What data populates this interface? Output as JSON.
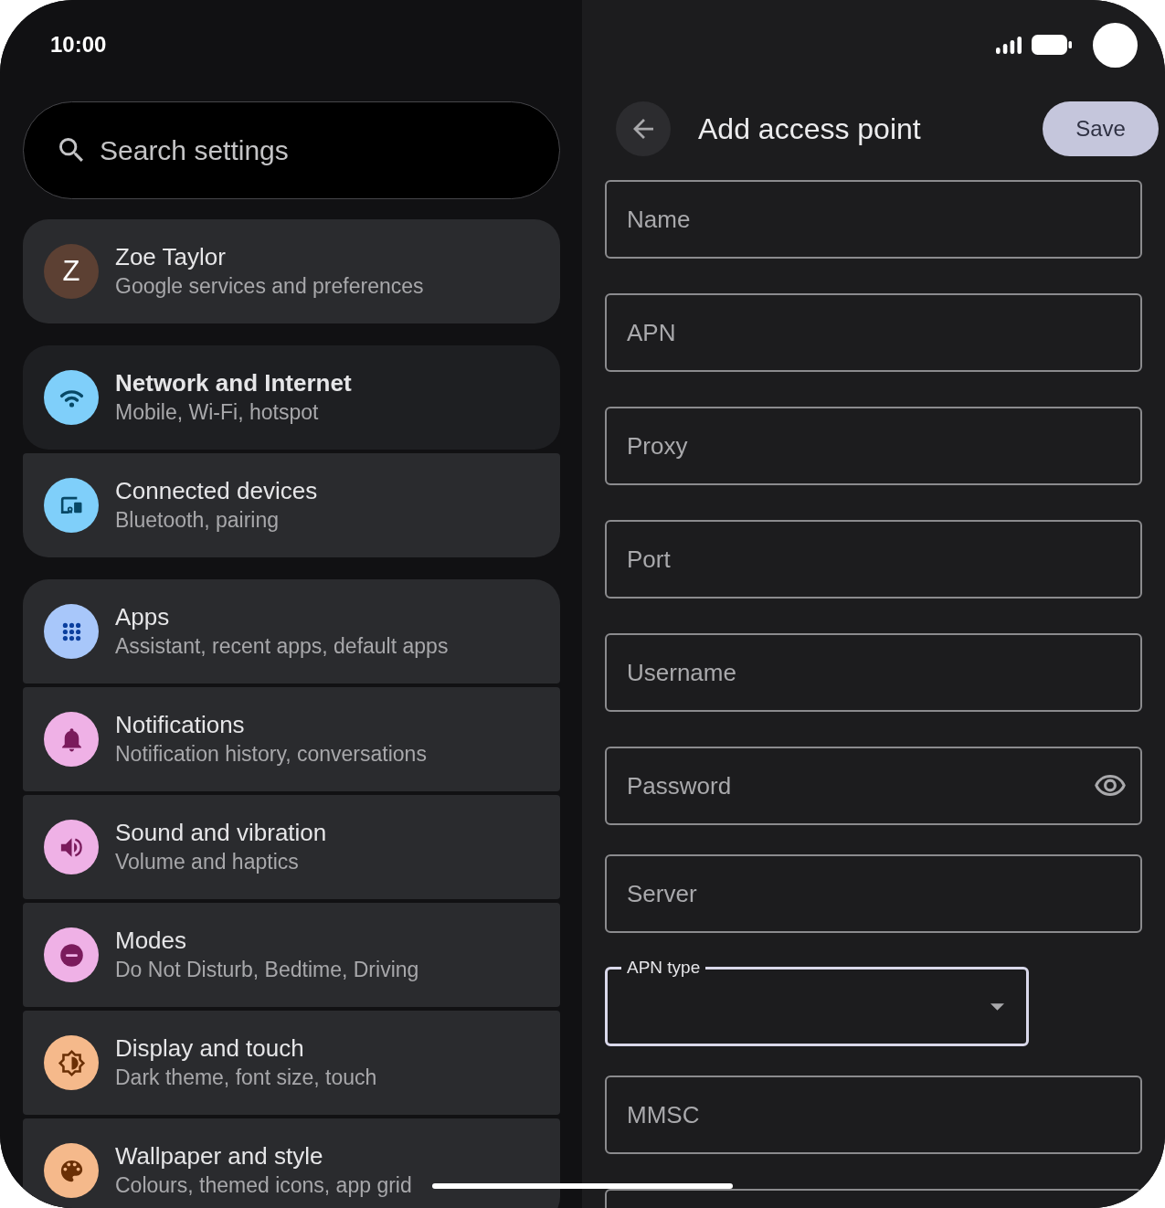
{
  "status_bar": {
    "time": "10:00"
  },
  "search": {
    "placeholder": "Search settings"
  },
  "settings_groups": [
    {
      "items": [
        {
          "kind": "account",
          "initial": "Z",
          "title": "Zoe Taylor",
          "subtitle": "Google services and preferences",
          "color": "#5c4033",
          "selected": false
        }
      ]
    },
    {
      "items": [
        {
          "kind": "setting",
          "title": "Network and Internet",
          "subtitle": "Mobile, Wi-Fi, hotspot",
          "color": "#7fcffa",
          "selected": true
        },
        {
          "kind": "setting",
          "title": "Connected devices",
          "subtitle": "Bluetooth, pairing",
          "color": "#7fcffa",
          "selected": false
        }
      ]
    },
    {
      "items": [
        {
          "kind": "setting",
          "title": "Apps",
          "subtitle": "Assistant, recent apps, default apps",
          "color": "#a8c7fa",
          "selected": false
        },
        {
          "kind": "setting",
          "title": "Notifications",
          "subtitle": "Notification history, conversations",
          "color": "#efb1e6",
          "selected": false
        },
        {
          "kind": "setting",
          "title": "Sound and vibration",
          "subtitle": "Volume and haptics",
          "color": "#efb1e6",
          "selected": false
        },
        {
          "kind": "setting",
          "title": "Modes",
          "subtitle": "Do Not Disturb, Bedtime, Driving",
          "color": "#efb1e6",
          "selected": false
        },
        {
          "kind": "setting",
          "title": "Display and touch",
          "subtitle": "Dark theme, font size, touch",
          "color": "#f5b98b",
          "selected": false
        },
        {
          "kind": "setting",
          "title": "Wallpaper and style",
          "subtitle": "Colours, themed icons, app grid",
          "color": "#f5b98b",
          "selected": false
        }
      ]
    }
  ],
  "detail": {
    "title": "Add access point",
    "save_button": "Save",
    "fields": [
      {
        "kind": "text",
        "placeholder": "Name",
        "focused": false
      },
      {
        "kind": "text",
        "placeholder": "APN",
        "focused": false
      },
      {
        "kind": "text",
        "placeholder": "Proxy",
        "focused": false
      },
      {
        "kind": "text",
        "placeholder": "Port",
        "focused": false
      },
      {
        "kind": "text",
        "placeholder": "Username",
        "focused": false
      },
      {
        "kind": "password",
        "placeholder": "Password",
        "focused": false
      },
      {
        "kind": "text",
        "placeholder": "Server",
        "focused": false
      },
      {
        "kind": "select",
        "label": "APN type",
        "focused": true
      },
      {
        "kind": "text",
        "placeholder": "MMSC",
        "focused": false
      },
      {
        "kind": "text",
        "focused": false
      }
    ]
  }
}
